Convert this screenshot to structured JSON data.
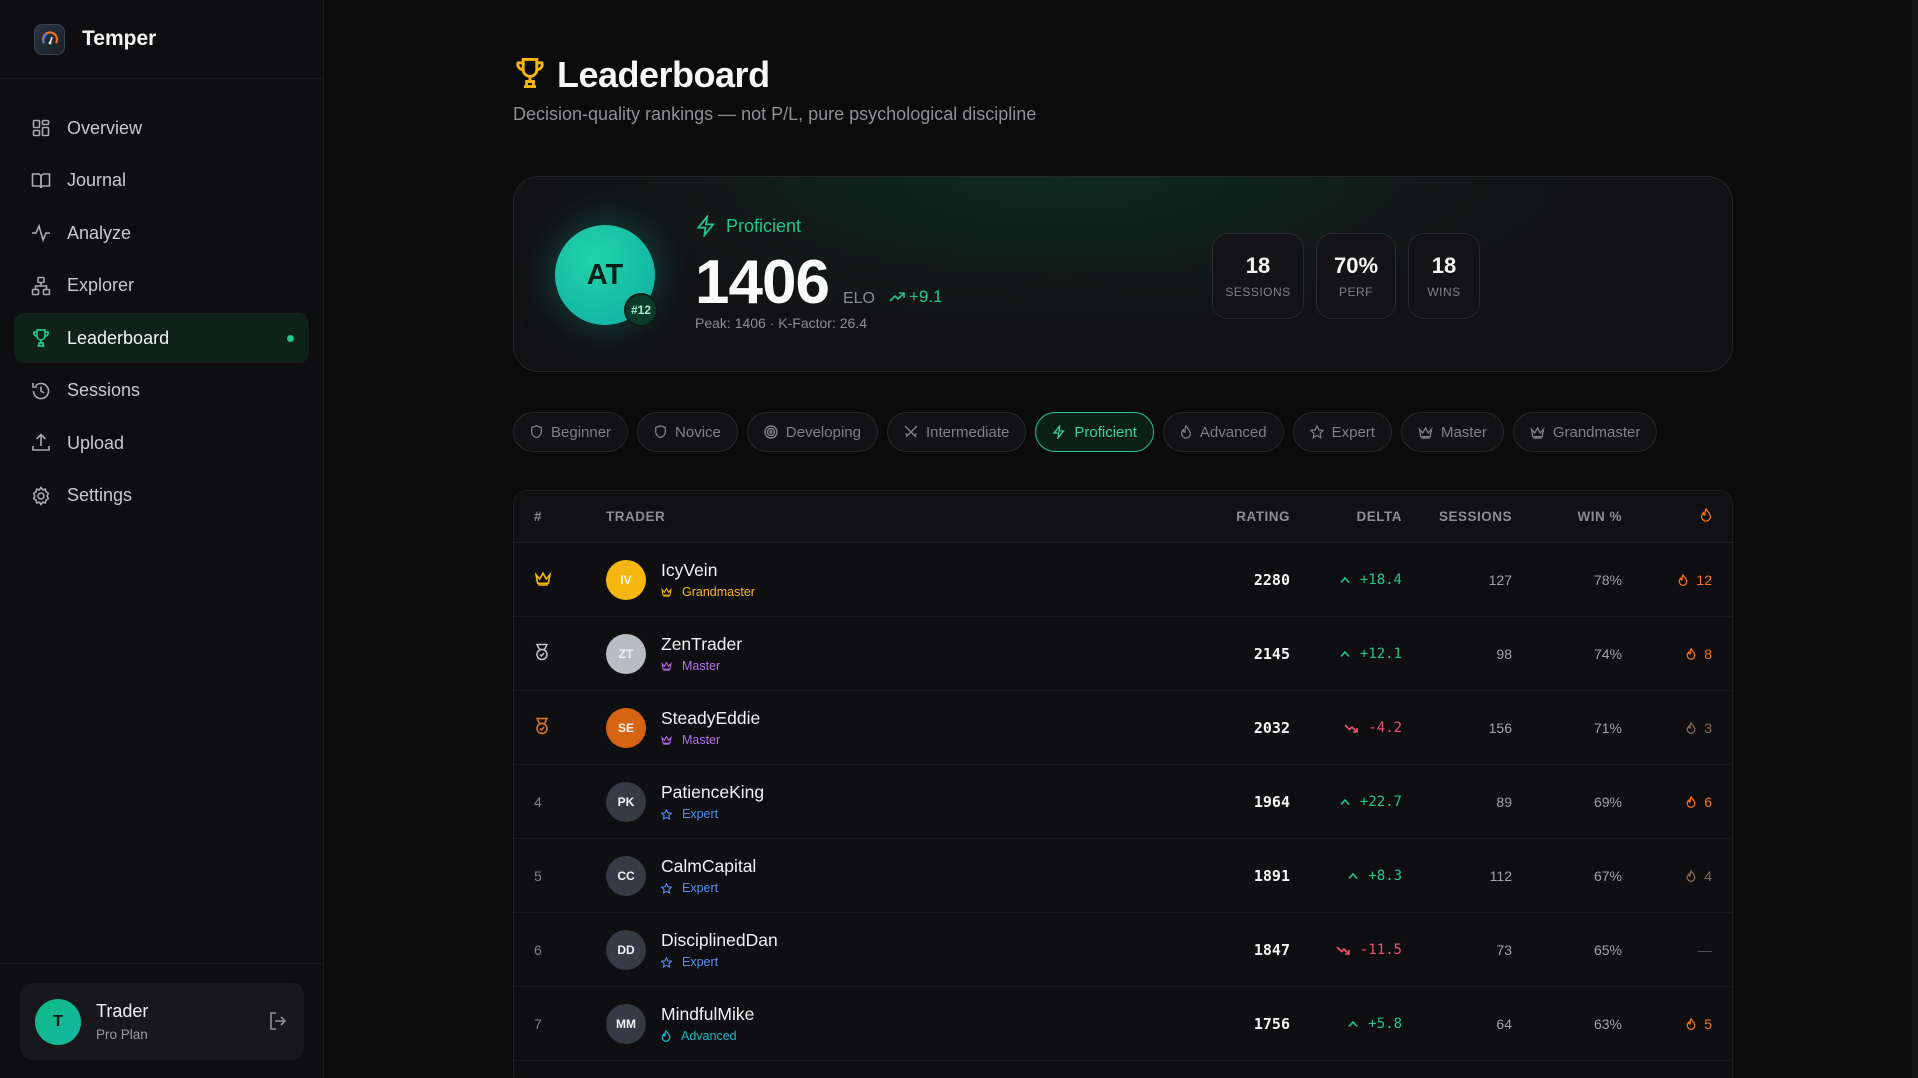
{
  "app": {
    "name": "Temper"
  },
  "nav": [
    {
      "label": "Overview",
      "icon": "grid-icon"
    },
    {
      "label": "Journal",
      "icon": "book-icon"
    },
    {
      "label": "Analyze",
      "icon": "activity-icon"
    },
    {
      "label": "Explorer",
      "icon": "network-icon"
    },
    {
      "label": "Leaderboard",
      "icon": "trophy-icon",
      "active": true
    },
    {
      "label": "Sessions",
      "icon": "history-icon"
    },
    {
      "label": "Upload",
      "icon": "upload-icon"
    },
    {
      "label": "Settings",
      "icon": "gear-icon"
    }
  ],
  "user": {
    "initial": "T",
    "name": "Trader",
    "plan": "Pro Plan"
  },
  "page": {
    "title": "Leaderboard",
    "subtitle": "Decision-quality rankings — not P/L, pure psychological discipline"
  },
  "me": {
    "initials": "AT",
    "rank": "#12",
    "tier": "Proficient",
    "elo": "1406",
    "elo_label": "ELO",
    "delta": "+9.1",
    "peak": "Peak: 1406 · K-Factor: 26.4",
    "stats": [
      {
        "value": "18",
        "label": "SESSIONS"
      },
      {
        "value": "70%",
        "label": "PERF"
      },
      {
        "value": "18",
        "label": "WINS"
      }
    ]
  },
  "tiers": [
    {
      "label": "Beginner",
      "icon": "shield-icon"
    },
    {
      "label": "Novice",
      "icon": "shield-icon"
    },
    {
      "label": "Developing",
      "icon": "target-icon"
    },
    {
      "label": "Intermediate",
      "icon": "swords-icon"
    },
    {
      "label": "Proficient",
      "icon": "bolt-icon",
      "active": true
    },
    {
      "label": "Advanced",
      "icon": "flame-icon"
    },
    {
      "label": "Expert",
      "icon": "star-icon"
    },
    {
      "label": "Master",
      "icon": "crown-icon"
    },
    {
      "label": "Grandmaster",
      "icon": "crown-icon"
    }
  ],
  "table": {
    "headers": {
      "rank": "#",
      "trader": "TRADER",
      "rating": "RATING",
      "delta": "DELTA",
      "sessions": "SESSIONS",
      "win": "WIN %",
      "streak": "streak-flame-icon"
    },
    "rows": [
      {
        "rank": "1",
        "rank_icon": "crown-icon",
        "initials": "IV",
        "name": "IcyVein",
        "tier": "Grandmaster",
        "tier_color": "#f5b70f",
        "avatar_color": "#f5b70f",
        "rating": "2280",
        "delta": "+18.4",
        "dir": "up",
        "sessions": "127",
        "win": "78%",
        "streak": "12",
        "streak_color": "#f97316"
      },
      {
        "rank": "2",
        "rank_icon": "medal-silver-icon",
        "initials": "ZT",
        "name": "ZenTrader",
        "tier": "Master",
        "tier_color": "#b46cf0",
        "avatar_color": "#b8bcc4",
        "rating": "2145",
        "delta": "+12.1",
        "dir": "up",
        "sessions": "98",
        "win": "74%",
        "streak": "8",
        "streak_color": "#f97316"
      },
      {
        "rank": "3",
        "rank_icon": "medal-bronze-icon",
        "initials": "SE",
        "name": "SteadyEddie",
        "tier": "Master",
        "tier_color": "#b46cf0",
        "avatar_color": "#d76412",
        "rating": "2032",
        "delta": "-4.2",
        "dir": "down",
        "sessions": "156",
        "win": "71%",
        "streak": "3",
        "streak_color": "#8a6a55"
      },
      {
        "rank": "4",
        "initials": "PK",
        "name": "PatienceKing",
        "tier": "Expert",
        "tier_color": "#4f8ff5",
        "avatar_color": "#353a45",
        "rating": "1964",
        "delta": "+22.7",
        "dir": "up",
        "sessions": "89",
        "win": "69%",
        "streak": "6",
        "streak_color": "#f97316"
      },
      {
        "rank": "5",
        "initials": "CC",
        "name": "CalmCapital",
        "tier": "Expert",
        "tier_color": "#4f8ff5",
        "avatar_color": "#353a45",
        "rating": "1891",
        "delta": "+8.3",
        "dir": "up",
        "sessions": "112",
        "win": "67%",
        "streak": "4",
        "streak_color": "#8a6a55"
      },
      {
        "rank": "6",
        "initials": "DD",
        "name": "DisciplinedDan",
        "tier": "Expert",
        "tier_color": "#4f8ff5",
        "avatar_color": "#353a45",
        "rating": "1847",
        "delta": "-11.5",
        "dir": "down",
        "sessions": "73",
        "win": "65%",
        "streak": "—",
        "streak_color": "#55555b"
      },
      {
        "rank": "7",
        "initials": "MM",
        "name": "MindfulMike",
        "tier": "Advanced",
        "tier_color": "#14b8c8",
        "avatar_color": "#353a45",
        "rating": "1756",
        "delta": "+5.8",
        "dir": "up",
        "sessions": "64",
        "win": "63%",
        "streak": "5",
        "streak_color": "#f97316"
      }
    ]
  }
}
